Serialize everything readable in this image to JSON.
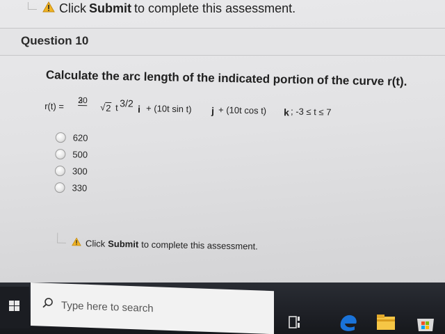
{
  "notice": {
    "prefix": "Click",
    "action": "Submit",
    "suffix": "to complete this assessment."
  },
  "question": {
    "title": "Question 10",
    "prompt": "Calculate the arc length of the indicated portion of the curve r(t).",
    "equation": {
      "lhs": "r(t) =",
      "frac_num": "20",
      "frac_den": "3",
      "sqrt_radicand": "2",
      "t": "t",
      "power": "3/2",
      "i": "i",
      "j_term": "+ (10t sin t)",
      "j": "j",
      "k_term": "+ (10t cos t)",
      "k": "k",
      "range": "; -3 ≤ t ≤ 7"
    },
    "options": [
      "620",
      "500",
      "300",
      "330"
    ]
  },
  "taskbar": {
    "search_placeholder": "Type here to search"
  },
  "colors": {
    "warning": "#f0b323",
    "taskbar": "#1e2026",
    "search_box": "#f2f2f2",
    "edge_blue": "#1a73d9",
    "folder_yellow": "#f6c645"
  },
  "icons": [
    "warning-icon",
    "search-icon",
    "windows-icon",
    "task-view-icon",
    "edge-icon",
    "file-explorer-icon",
    "store-icon"
  ]
}
